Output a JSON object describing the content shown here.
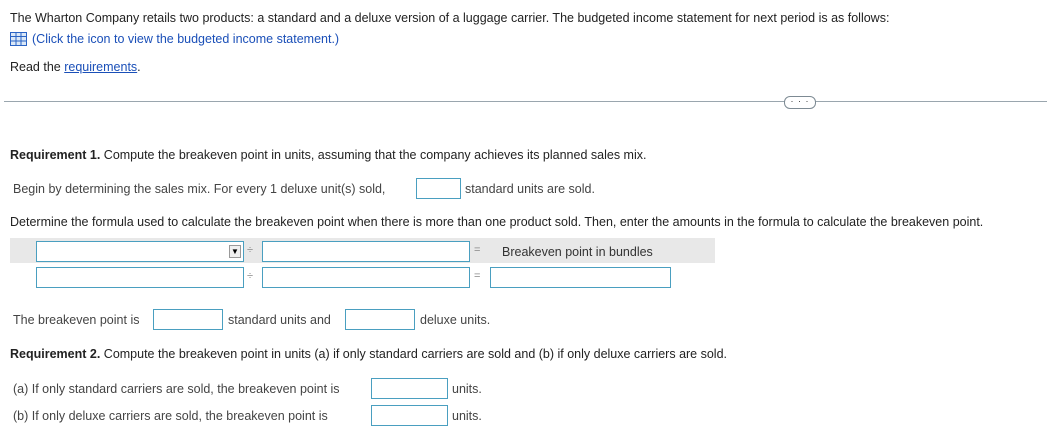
{
  "intro": {
    "text": "The Wharton Company retails two products: a standard and a deluxe version of a luggage carrier. The budgeted income statement for next period is as follows:",
    "table_icon": "table-grid-icon",
    "click_text": "(Click the icon to view the budgeted income statement.)",
    "read_prefix": "Read the ",
    "requirements_link": "requirements",
    "read_suffix": "."
  },
  "divider": {
    "more_label": "· · ·"
  },
  "req1": {
    "heading_bold": "Requirement 1.",
    "heading_text": " Compute the breakeven point in units, assuming that the company achieves its planned sales mix.",
    "mix_prefix": "Begin by determining the sales mix. For every 1 deluxe unit(s) sold,",
    "mix_suffix": "standard units are sold.",
    "formula_instruction": "Determine the formula used to calculate the breakeven point when there is more than one product sold. Then, enter the amounts in the formula to calculate the breakeven point.",
    "divide_symbol": "÷",
    "equals_symbol": "=",
    "result_label": "Breakeven point in bundles",
    "be_prefix": "The breakeven point is",
    "be_middle": "standard units and",
    "be_suffix": "deluxe units."
  },
  "req2": {
    "heading_bold": "Requirement 2.",
    "heading_text": " Compute the breakeven point in units (a) if only standard carriers are sold and (b) if only deluxe carriers are sold.",
    "a_label": "(a) If only standard carriers are sold, the breakeven point is",
    "b_label": "(b) If only deluxe carriers are sold, the breakeven point is",
    "units_a": "units.",
    "units_b": "units."
  },
  "colors": {
    "accent": "#1a4fb8",
    "input_border": "#4a9fc0",
    "band": "#e8e8e8"
  }
}
